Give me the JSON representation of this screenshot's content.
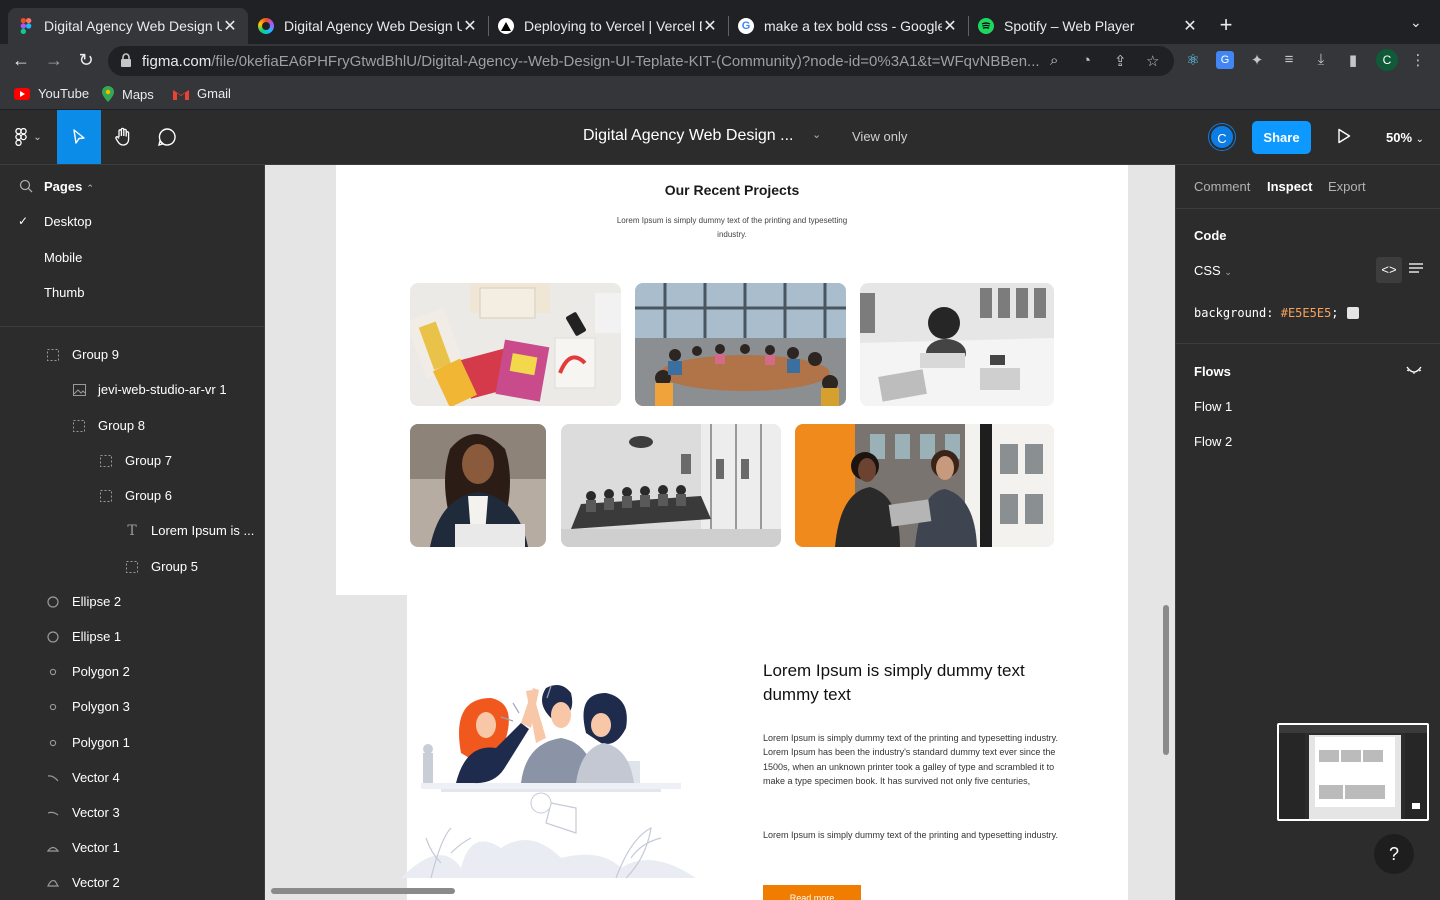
{
  "browser": {
    "tabs": [
      {
        "title": "Digital Agency Web Design UI T",
        "favicon": "figma-icon",
        "active": true
      },
      {
        "title": "Digital Agency Web Design UI T",
        "favicon": "figma-community-icon",
        "active": false
      },
      {
        "title": "Deploying to Vercel | Vercel Do",
        "favicon": "vercel-icon",
        "active": false
      },
      {
        "title": "make a tex bold css - Google S",
        "favicon": "google-icon",
        "active": false
      },
      {
        "title": "Spotify – Web Player",
        "favicon": "spotify-icon",
        "active": false
      }
    ],
    "url_domain": "figma.com",
    "url_path": "/file/0kefiaEA6PHFryGtwdBhlU/Digital-Agency--Web-Design-UI-Teplate-KIT-(Community)?node-id=0%3A1&t=WFqvNBBen...",
    "bookmarks": [
      "YouTube",
      "Maps",
      "Gmail"
    ],
    "profile_initial": "C"
  },
  "figma": {
    "doc_title": "Digital Agency Web Design ...",
    "view_mode": "View only",
    "user_initial": "C",
    "share_label": "Share",
    "zoom": "50%",
    "pages_label": "Pages",
    "pages": [
      "Desktop",
      "Mobile",
      "Thumb"
    ],
    "active_page": "Desktop",
    "layers": [
      {
        "name": "Group 9",
        "type": "group",
        "indent": 0
      },
      {
        "name": "jevi-web-studio-ar-vr 1",
        "type": "image",
        "indent": 1
      },
      {
        "name": "Group 8",
        "type": "group",
        "indent": 1
      },
      {
        "name": "Group 7",
        "type": "group",
        "indent": 2
      },
      {
        "name": "Group 6",
        "type": "group",
        "indent": 2
      },
      {
        "name": "Lorem Ipsum is ...",
        "type": "text",
        "indent": 3
      },
      {
        "name": "Group 5",
        "type": "group",
        "indent": 3
      },
      {
        "name": "Ellipse 2",
        "type": "ellipse",
        "indent": 0
      },
      {
        "name": "Ellipse 1",
        "type": "ellipse",
        "indent": 0
      },
      {
        "name": "Polygon 2",
        "type": "polygon",
        "indent": 0
      },
      {
        "name": "Polygon 3",
        "type": "polygon",
        "indent": 0
      },
      {
        "name": "Polygon 1",
        "type": "polygon",
        "indent": 0
      },
      {
        "name": "Vector 4",
        "type": "vector",
        "indent": 0
      },
      {
        "name": "Vector 3",
        "type": "vector",
        "indent": 0
      },
      {
        "name": "Vector 1",
        "type": "vector",
        "indent": 0
      },
      {
        "name": "Vector 2",
        "type": "vector",
        "indent": 0
      }
    ],
    "right_tabs": [
      "Comment",
      "Inspect",
      "Export"
    ],
    "active_right_tab": "Inspect",
    "code_label": "Code",
    "code_lang": "CSS",
    "css_property": "background:",
    "css_value": "#E5E5E5",
    "css_end": ";",
    "flows_label": "Flows",
    "flows": [
      "Flow 1",
      "Flow 2"
    ],
    "help": "?"
  },
  "design": {
    "section_title": "Our Recent Projects",
    "section_sub": "Lorem Ipsum is simply dummy text of the printing and typesetting industry.",
    "heading": "Lorem Ipsum is simply dummy text dummy text",
    "para1": "Lorem Ipsum is simply dummy text of the printing and typesetting industry. Lorem Ipsum has been the industry's standard dummy text ever since the 1500s, when an unknown printer took a galley of type and scrambled it to make a type specimen book. It has survived not only five centuries,",
    "para2": "Lorem Ipsum is simply dummy text of the printing and typesetting industry.",
    "button": "Read more"
  },
  "colors": {
    "accent": "#0d99ff",
    "canvas_bg": "#E5E5E5",
    "orange": "#f07c00"
  }
}
